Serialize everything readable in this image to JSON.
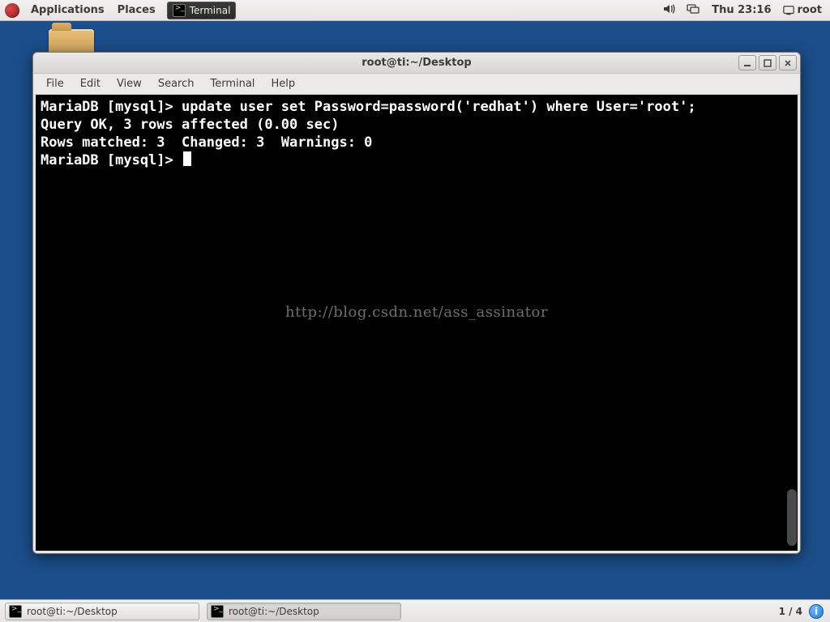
{
  "top_panel": {
    "applications": "Applications",
    "places": "Places",
    "launcher_label": "Terminal",
    "clock": "Thu 23:16",
    "user": "root"
  },
  "window": {
    "title": "root@ti:~/Desktop",
    "menus": {
      "file": "File",
      "edit": "Edit",
      "view": "View",
      "search": "Search",
      "terminal": "Terminal",
      "help": "Help"
    }
  },
  "terminal": {
    "lines": [
      "MariaDB [mysql]> update user set Password=password('redhat') where User='root';",
      "Query OK, 3 rows affected (0.00 sec)",
      "Rows matched: 3  Changed: 3  Warnings: 0",
      "",
      "MariaDB [mysql]> "
    ],
    "watermark": "http://blog.csdn.net/ass_assinator"
  },
  "taskbar": {
    "tasks": [
      {
        "label": "root@ti:~/Desktop"
      },
      {
        "label": "root@ti:~/Desktop"
      }
    ],
    "workspace": "1 / 4",
    "info_badge": "i"
  }
}
